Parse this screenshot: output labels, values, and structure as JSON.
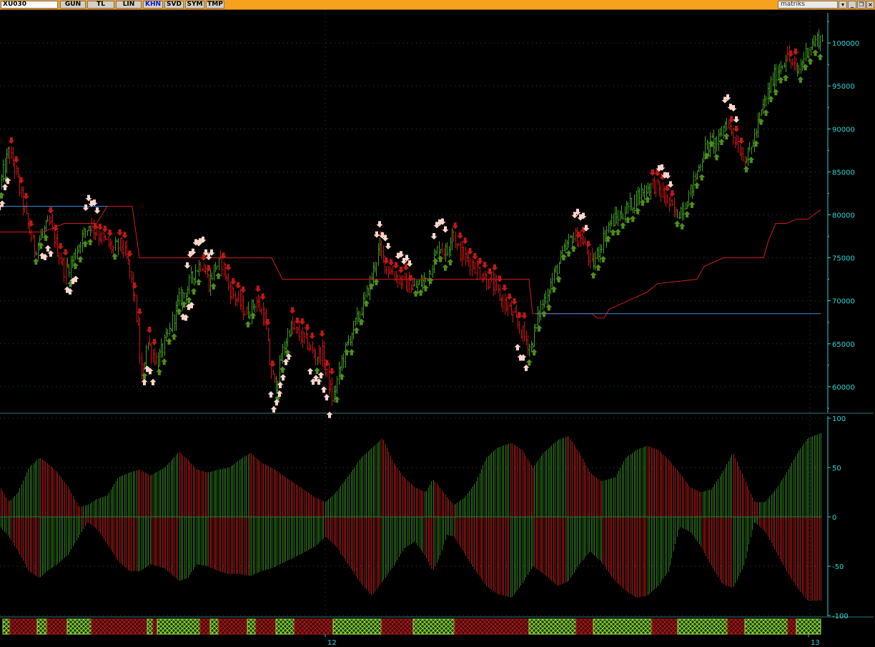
{
  "toolbar": {
    "symbol": "XU030",
    "buttons": [
      {
        "label": "GUN",
        "active": false
      },
      {
        "label": "TL",
        "active": false
      },
      {
        "label": "LIN",
        "active": false
      },
      {
        "label": "KHN",
        "active": true
      },
      {
        "label": "SVD",
        "active": false
      },
      {
        "label": "SYM",
        "active": false
      },
      {
        "label": "TMP",
        "active": false
      }
    ],
    "brand": "matriks",
    "window_icons": [
      "dropdown-icon",
      "minimize-icon",
      "restore-icon",
      "close-icon"
    ]
  },
  "colors": {
    "up_bar": "#3f9c1f",
    "down_bar": "#c81414",
    "arrow_up_dark": "#4e8e1b",
    "arrow_down_dark": "#c01818",
    "arrow_light": "#ffd6cc",
    "trail_red": "#d21c1c",
    "trail_blue": "#3a8ad6",
    "axis_text": "#2ad4d4",
    "osc_pos": "#2e7a1a",
    "osc_neg": "#a81a16",
    "ribbon_green": "#9ae23a",
    "ribbon_red": "#b51616"
  },
  "chart_data": [
    {
      "type": "line",
      "panel": "price",
      "yticks": [
        60000,
        65000,
        70000,
        75000,
        80000,
        85000,
        90000,
        95000,
        100000
      ],
      "ylim": [
        57000,
        103500
      ],
      "xlim": [
        0,
        1150
      ],
      "series": [
        {
          "role": "price",
          "x": [
            0,
            12,
            22,
            35,
            48,
            60,
            70,
            80,
            90,
            100,
            112,
            125,
            135,
            145,
            158,
            170,
            180,
            188,
            193,
            198,
            205,
            212,
            220,
            235,
            250,
            262,
            272,
            282,
            292,
            300,
            310,
            320,
            332,
            345,
            358,
            370,
            378,
            385,
            395,
            405,
            418,
            430,
            440,
            450,
            458,
            465,
            478,
            490,
            500,
            510,
            520,
            530,
            540,
            552,
            565,
            580,
            595,
            605,
            615,
            625,
            632,
            640,
            650,
            665,
            680,
            692,
            702,
            712,
            722,
            732,
            742,
            755,
            770,
            785,
            800,
            815,
            828,
            840,
            852,
            868,
            885,
            900,
            915,
            930,
            945,
            955,
            965,
            975,
            985,
            995,
            1005,
            1015,
            1025,
            1035,
            1045,
            1055,
            1065,
            1075,
            1085,
            1100,
            1115,
            1130,
            1145
          ],
          "y": [
            83500,
            87500,
            85000,
            80000,
            76000,
            78000,
            79000,
            76000,
            73500,
            74500,
            77000,
            79000,
            78000,
            77000,
            76000,
            76500,
            74000,
            70000,
            66500,
            60000,
            65500,
            64000,
            63000,
            66000,
            70000,
            71500,
            73500,
            74500,
            72000,
            74000,
            74500,
            71500,
            70000,
            68500,
            70000,
            68000,
            62000,
            60000,
            64000,
            67000,
            66000,
            65000,
            63500,
            64000,
            61000,
            58500,
            63000,
            66000,
            68000,
            70000,
            73000,
            76000,
            74000,
            73000,
            72000,
            71500,
            72500,
            74500,
            76500,
            75500,
            78500,
            76000,
            75000,
            74000,
            72500,
            71500,
            70000,
            69000,
            67500,
            66000,
            64500,
            69000,
            72000,
            75000,
            77500,
            77000,
            74000,
            76500,
            79000,
            80000,
            81500,
            83000,
            83500,
            82000,
            80000,
            81000,
            82500,
            85000,
            87500,
            88500,
            88500,
            91000,
            89500,
            87500,
            86500,
            89000,
            92000,
            94500,
            96500,
            98500,
            96500,
            99500,
            100500
          ]
        },
        {
          "role": "trail_red",
          "x": [
            0,
            60,
            90,
            110,
            135,
            150,
            165,
            185,
            195,
            380,
            395,
            740,
            745,
            828,
            835,
            845,
            852,
            905,
            920,
            975,
            985,
            1012,
            1020,
            1068,
            1075,
            1085,
            1100,
            1115,
            1130,
            1148
          ],
          "y": [
            78000,
            78000,
            79000,
            79000,
            79000,
            81000,
            81000,
            81000,
            75000,
            75000,
            72500,
            72500,
            68500,
            68500,
            68000,
            68000,
            69000,
            71000,
            72000,
            72500,
            74000,
            75000,
            75000,
            75000,
            77000,
            79000,
            79000,
            79500,
            79500,
            80600
          ]
        },
        {
          "role": "trail_blue",
          "x": [
            0,
            150
          ],
          "y": [
            81000,
            81000
          ]
        },
        {
          "role": "trail_blue",
          "x": [
            750,
            1148
          ],
          "y": [
            68500,
            68500
          ]
        }
      ]
    },
    {
      "type": "bar",
      "panel": "oscillator",
      "yticks": [
        -100,
        -50,
        0,
        50,
        100
      ],
      "ylim": [
        -100,
        100
      ],
      "xlim": [
        0,
        1150
      ],
      "series": [
        {
          "role": "pos",
          "x": [
            0,
            12,
            25,
            40,
            55,
            65,
            80,
            95,
            110,
            122,
            135,
            150,
            165,
            180,
            195,
            210,
            230,
            250,
            262,
            275,
            290,
            305,
            320,
            335,
            350,
            365,
            380,
            400,
            420,
            440,
            455,
            470,
            490,
            505,
            520,
            535,
            550,
            565,
            580,
            595,
            605,
            615,
            625,
            635,
            650,
            665,
            680,
            695,
            715,
            730,
            745,
            760,
            780,
            795,
            810,
            825,
            840,
            860,
            875,
            890,
            905,
            920,
            935,
            950,
            965,
            980,
            995,
            1010,
            1025,
            1040,
            1055,
            1070,
            1085,
            1100,
            1115,
            1130,
            1148
          ],
          "y": [
            30,
            15,
            25,
            50,
            60,
            55,
            45,
            30,
            10,
            12,
            18,
            22,
            40,
            45,
            48,
            42,
            50,
            66,
            58,
            48,
            45,
            48,
            50,
            58,
            65,
            55,
            50,
            40,
            30,
            20,
            15,
            25,
            45,
            60,
            70,
            80,
            55,
            40,
            30,
            25,
            38,
            30,
            20,
            12,
            20,
            35,
            60,
            70,
            75,
            68,
            50,
            65,
            78,
            82,
            65,
            45,
            36,
            40,
            60,
            68,
            72,
            68,
            58,
            45,
            30,
            25,
            28,
            45,
            65,
            40,
            15,
            15,
            28,
            45,
            65,
            80,
            85
          ]
        },
        {
          "role": "neg",
          "x": [
            0,
            12,
            25,
            40,
            55,
            65,
            80,
            95,
            110,
            122,
            135,
            150,
            165,
            180,
            195,
            210,
            230,
            250,
            262,
            275,
            290,
            305,
            320,
            335,
            350,
            365,
            380,
            400,
            420,
            440,
            455,
            470,
            490,
            505,
            520,
            535,
            550,
            565,
            580,
            595,
            605,
            615,
            625,
            635,
            650,
            665,
            680,
            695,
            715,
            730,
            745,
            760,
            780,
            795,
            810,
            825,
            840,
            860,
            875,
            890,
            905,
            920,
            935,
            950,
            965,
            980,
            995,
            1010,
            1025,
            1040,
            1055,
            1070,
            1085,
            1100,
            1115,
            1130,
            1148
          ],
          "y": [
            -10,
            -20,
            -35,
            -55,
            -62,
            -55,
            -48,
            -38,
            -20,
            -5,
            -12,
            -28,
            -45,
            -55,
            -55,
            -48,
            -52,
            -65,
            -62,
            -48,
            -50,
            -55,
            -58,
            -58,
            -60,
            -55,
            -52,
            -45,
            -38,
            -30,
            -20,
            -30,
            -52,
            -68,
            -80,
            -65,
            -50,
            -32,
            -25,
            -40,
            -55,
            -40,
            -18,
            -20,
            -38,
            -55,
            -70,
            -78,
            -82,
            -68,
            -50,
            -58,
            -70,
            -65,
            -48,
            -35,
            -45,
            -65,
            -75,
            -82,
            -80,
            -70,
            -55,
            -10,
            -15,
            -30,
            -50,
            -68,
            -72,
            -50,
            -5,
            -15,
            -35,
            -55,
            -72,
            -85,
            -85
          ]
        }
      ]
    }
  ],
  "xaxis": {
    "labels": [
      "12",
      "13"
    ]
  }
}
